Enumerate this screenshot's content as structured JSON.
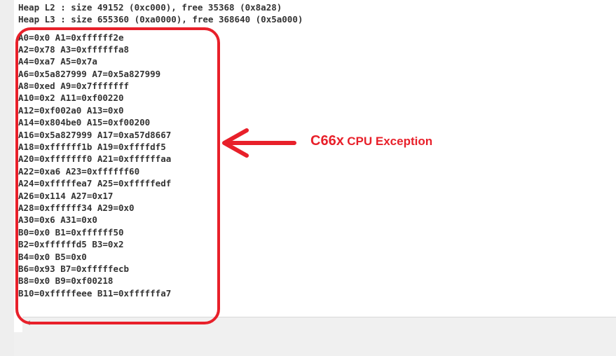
{
  "console": {
    "lines": [
      "Heap L2 : size 49152 (0xc000), free 35368 (0x8a28)",
      "Heap L3 : size 655360 (0xa0000), free 368640 (0x5a000)",
      "A0=0x0 A1=0xffffff2e",
      "A2=0x78 A3=0xffffffa8",
      "A4=0xa7 A5=0x7a",
      "A6=0x5a827999 A7=0x5a827999",
      "A8=0xed A9=0x7fffffff",
      "A10=0x2 A11=0xf00220",
      "A12=0xf002a0 A13=0x0",
      "A14=0x804be0 A15=0xf00200",
      "A16=0x5a827999 A17=0xa57d8667",
      "A18=0xffffff1b A19=0xffffdf5",
      "A20=0xfffffff0 A21=0xffffffaa",
      "A22=0xa6 A23=0xffffff60",
      "A24=0xfffffea7 A25=0xfffffedf",
      "A26=0x114 A27=0x17",
      "A28=0xffffff34 A29=0x0",
      "A30=0x6 A31=0x0",
      "B0=0x0 B1=0xffffff50",
      "B2=0xffffffd5 B3=0x2",
      "B4=0x0 B5=0x0",
      "B6=0x93 B7=0xfffffecb",
      "B8=0x0 B9=0xf00218",
      "B10=0xfffffeee B11=0xffffffa7"
    ]
  },
  "annotation": {
    "prefix": "C66x",
    "text": "CPU Exception",
    "color": "#e8202a"
  },
  "scrollbar": {
    "left_icon": "scroll-left-icon"
  }
}
